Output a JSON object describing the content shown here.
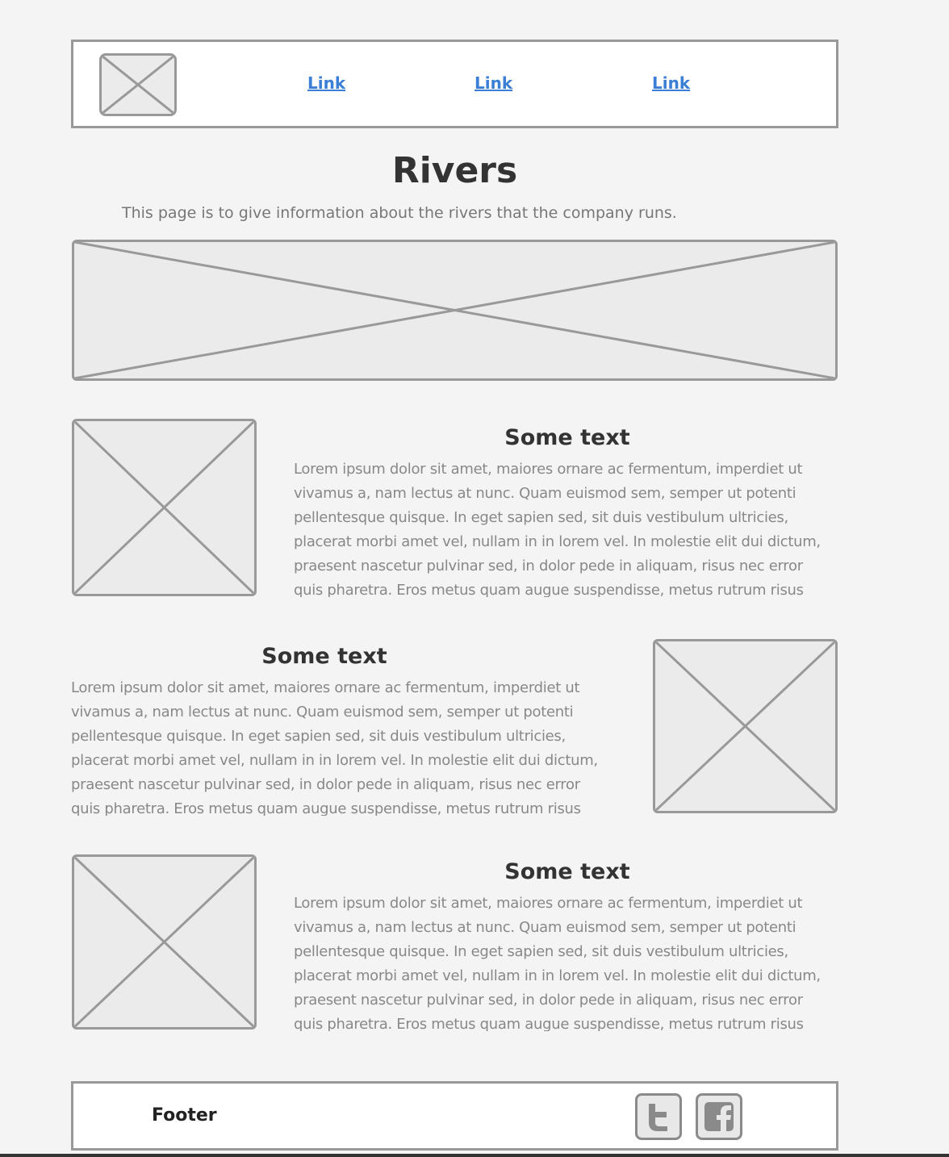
{
  "header": {
    "links": [
      "Link",
      "Link",
      "Link"
    ]
  },
  "page": {
    "title": "Rivers",
    "intro": "This page is to give information about the rivers that the company runs."
  },
  "sections": [
    {
      "heading": "Some text",
      "lines": [
        "Lorem ipsum dolor sit amet, maiores ornare ac fermentum, imperdiet ut",
        "vivamus a, nam lectus at nunc. Quam euismod sem, semper ut potenti",
        "pellentesque quisque. In eget sapien sed, sit duis vestibulum ultricies,",
        "placerat morbi amet vel, nullam in in lorem vel. In molestie elit dui dictum,",
        "praesent nascetur pulvinar sed, in dolor pede in aliquam, risus nec error",
        "quis pharetra. Eros metus quam augue suspendisse, metus rutrum risus"
      ]
    },
    {
      "heading": "Some text",
      "lines": [
        "Lorem ipsum dolor sit amet, maiores ornare ac fermentum, imperdiet ut",
        "vivamus a, nam lectus at nunc. Quam euismod sem, semper ut potenti",
        "pellentesque quisque. In eget sapien sed, sit duis vestibulum ultricies,",
        "placerat morbi amet vel, nullam in in lorem vel. In molestie elit dui dictum,",
        "praesent nascetur pulvinar sed, in dolor pede in aliquam, risus nec error",
        "quis pharetra. Eros metus quam augue suspendisse, metus rutrum risus"
      ]
    },
    {
      "heading": "Some text",
      "lines": [
        "Lorem ipsum dolor sit amet, maiores ornare ac fermentum, imperdiet ut",
        "vivamus a, nam lectus at nunc. Quam euismod sem, semper ut potenti",
        "pellentesque quisque. In eget sapien sed, sit duis vestibulum ultricies,",
        "placerat morbi amet vel, nullam in in lorem vel. In molestie elit dui dictum,",
        "praesent nascetur pulvinar sed, in dolor pede in aliquam, risus nec error",
        "quis pharetra. Eros metus quam augue suspendisse, metus rutrum risus"
      ]
    }
  ],
  "footer": {
    "label": "Footer",
    "social": [
      "twitter-icon",
      "facebook-icon"
    ]
  }
}
